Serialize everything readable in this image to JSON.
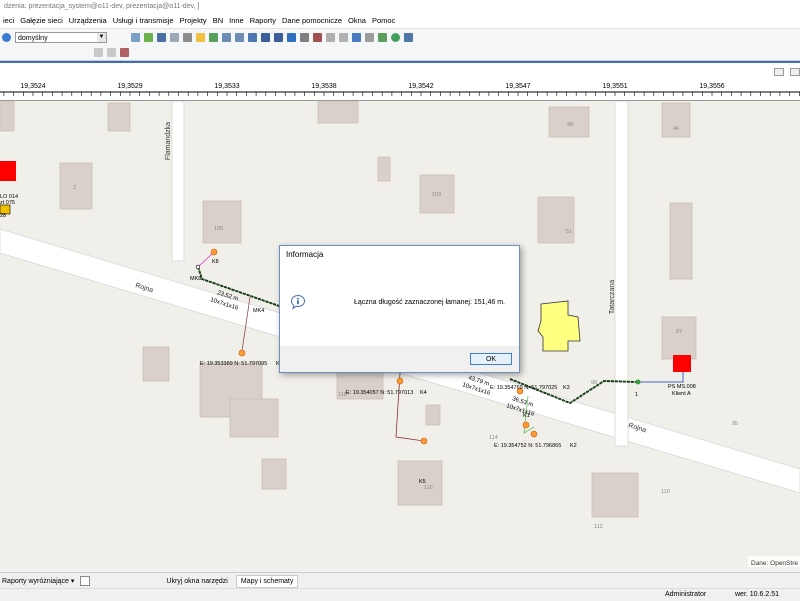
{
  "window": {
    "title": "dzenia: prezentacja_system@o11-dev, prezentacja@o11-dev, ]"
  },
  "menu": [
    "ieci",
    "Gałęzie sieci",
    "Urządzenia",
    "Usługi i transmisje",
    "Projekty",
    "BN",
    "Inne",
    "Raporty",
    "Dane pomocnicze",
    "Okna",
    "Pomoc"
  ],
  "toolbar": {
    "style_combo": "domyślny"
  },
  "ruler": {
    "labels": [
      "19,3524",
      "19,3529",
      "19,3533",
      "19,3538",
      "19,3542",
      "19,3547",
      "19,3551",
      "19,3556"
    ]
  },
  "map": {
    "streets": {
      "flamandzka": "Flamandzka",
      "rojna_left": "Rojna",
      "rojna_right": "Rojna",
      "tatarczana": "Tatarczana"
    },
    "house_numbers": [
      "49",
      "46",
      "2",
      "103",
      "105",
      "51",
      "97",
      "99",
      "114",
      "116",
      "95",
      "110",
      "112",
      "118"
    ],
    "labels": {
      "k8": "K8",
      "mk8": "MK8",
      "mk4": "MK4",
      "k4": "K4",
      "k3": "K3",
      "k2": "K2",
      "k5": "K5",
      "k1": "K1",
      "node_1": "1",
      "ps_name": "PS MS.008",
      "ps_client": "Klient A",
      "left_lines": [
        "LO 014",
        "zt 075",
        "28"
      ],
      "cable1_len": "23,52 m",
      "cable1_type": "10x7x1x16",
      "cable2_len": "43,79 m",
      "cable2_type": "10x7x1x16",
      "cable3_len": "36,53 m",
      "cable3_type": "10x7x1x16",
      "coord1": "E: 19.353389  N: 51.797095",
      "coord1_tail": "K",
      "coord2": "E: 19.354057  N: 51.797013",
      "coord3": "E: 19.354769  N: 51.797025",
      "coord4": "E: 19.354752  N: 51.796865"
    },
    "attribution": "Dane: OpenStre"
  },
  "dialog": {
    "title": "Informacja",
    "message": "Łączna długość zaznaczonej łamanej: 151,46 m.",
    "ok": "OK"
  },
  "bottom": {
    "reports_dropdown": "Raporty wyróżniające",
    "hide_tools": "Ukryj okna narzędzi",
    "maps_tab": "Mapy i schematy"
  },
  "status": {
    "user": "Administrator",
    "version": "wer. 10.6.2.51"
  },
  "colors": {
    "accent": "#3c6fb4",
    "red_station": "#ff0000",
    "yellow_building": "#ffff80",
    "node_orange": "#ff9a33"
  }
}
